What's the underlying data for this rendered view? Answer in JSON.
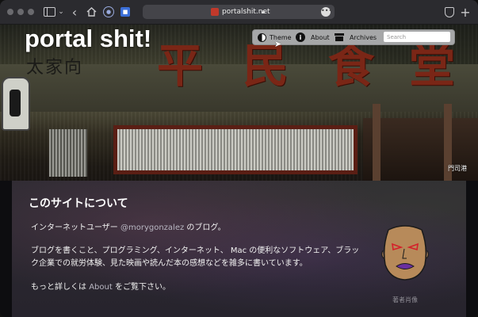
{
  "browser": {
    "url": "portalshit.net",
    "icons": [
      "sidebar-icon",
      "chevron-down-icon",
      "back-icon",
      "home-icon",
      "extension-icon",
      "bookmark-icon",
      "lock-icon",
      "more-icon",
      "shield-icon",
      "plus-icon"
    ],
    "colors": {
      "toolbar": "#2b2b2f",
      "url_bar": "#444449",
      "favicon": "#c0392b"
    }
  },
  "site": {
    "title": "portal shit!",
    "nav": {
      "theme_label": "Theme",
      "about_label": "About",
      "archives_label": "Archives",
      "search_placeholder": "Search"
    },
    "hero": {
      "sign_chars": [
        "平",
        "民",
        "食",
        "堂"
      ],
      "small_sign": "太家向",
      "caption": "門司港"
    }
  },
  "about": {
    "title": "このサイトについて",
    "line1_pre": "インターネットユーザー ",
    "line1_link": "@morygonzalez",
    "line1_post": " のブログ。",
    "line2": "ブログを書くこと、プログラミング、インターネット、 Mac の便利なソフトウェア、ブラッ",
    "line3": "ク企業での就労体験、見た映画や読んだ本の感想などを雑多に書いています。",
    "line4_pre": "もっと詳しくは ",
    "line4_link": "About",
    "line4_post": " をご覧下さい。",
    "portrait_caption": "著者肖像",
    "colors": {
      "link": "#b9b7c2",
      "portrait_face": "#b78a5a",
      "portrait_eyes": "#d4202a",
      "portrait_lips": "#6a2fa0"
    }
  }
}
